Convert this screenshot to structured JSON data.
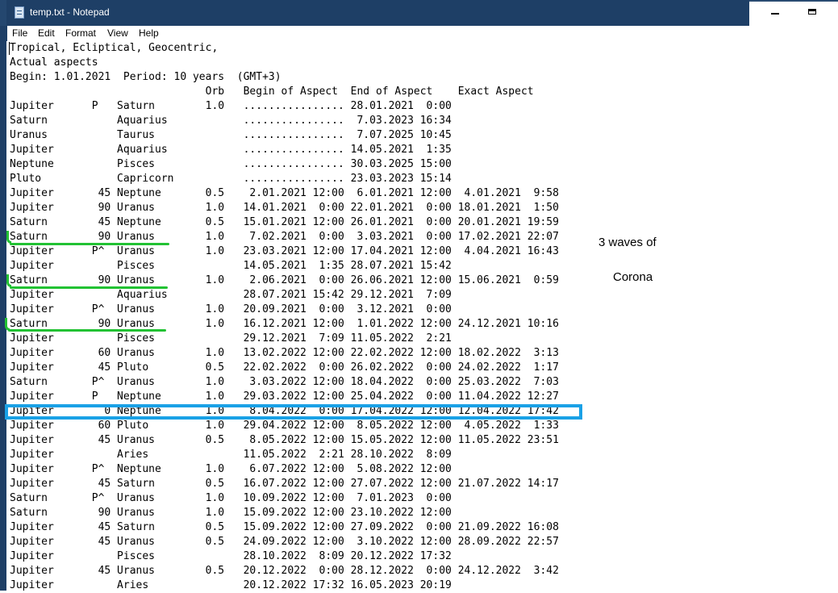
{
  "window": {
    "title": "temp.txt - Notepad",
    "controls": [
      "minimize",
      "maximize"
    ]
  },
  "menu": {
    "items": [
      {
        "label": "File"
      },
      {
        "label": "Edit"
      },
      {
        "label": "Format"
      },
      {
        "label": "View"
      },
      {
        "label": "Help"
      }
    ]
  },
  "document": {
    "lines": [
      "Tropical, Ecliptical, Geocentric,",
      "Actual aspects",
      "Begin: 1.01.2021  Period: 10 years  (GMT+3)",
      "                               Orb   Begin of Aspect  End of Aspect    Exact Aspect",
      "Jupiter      P   Saturn        1.0   ................ 28.01.2021  0:00",
      "Saturn           Aquarius            ................  7.03.2023 16:34",
      "Uranus           Taurus              ................  7.07.2025 10:45",
      "Jupiter          Aquarius            ................ 14.05.2021  1:35",
      "Neptune          Pisces              ................ 30.03.2025 15:00",
      "Pluto            Capricorn           ................ 23.03.2023 15:14",
      "Jupiter       45 Neptune       0.5    2.01.2021 12:00  6.01.2021 12:00  4.01.2021  9:58",
      "Jupiter       90 Uranus        1.0   14.01.2021  0:00 22.01.2021  0:00 18.01.2021  1:50",
      "Saturn        45 Neptune       0.5   15.01.2021 12:00 26.01.2021  0:00 20.01.2021 19:59",
      "Saturn        90 Uranus        1.0    7.02.2021  0:00  3.03.2021  0:00 17.02.2021 22:07",
      "Jupiter      P^  Uranus        1.0   23.03.2021 12:00 17.04.2021 12:00  4.04.2021 16:43",
      "Jupiter          Pisces              14.05.2021  1:35 28.07.2021 15:42",
      "Saturn        90 Uranus        1.0    2.06.2021  0:00 26.06.2021 12:00 15.06.2021  0:59",
      "Jupiter          Aquarius            28.07.2021 15:42 29.12.2021  7:09",
      "Jupiter      P^  Uranus        1.0   20.09.2021  0:00  3.12.2021  0:00",
      "Saturn        90 Uranus        1.0   16.12.2021 12:00  1.01.2022 12:00 24.12.2021 10:16",
      "Jupiter          Pisces              29.12.2021  7:09 11.05.2022  2:21",
      "Jupiter       60 Uranus        1.0   13.02.2022 12:00 22.02.2022 12:00 18.02.2022  3:13",
      "Jupiter       45 Pluto         0.5   22.02.2022  0:00 26.02.2022  0:00 24.02.2022  1:17",
      "Saturn       P^  Uranus        1.0    3.03.2022 12:00 18.04.2022  0:00 25.03.2022  7:03",
      "Jupiter      P   Neptune       1.0   29.03.2022 12:00 25.04.2022  0:00 11.04.2022 12:27",
      "Jupiter        0 Neptune       1.0    8.04.2022  0:00 17.04.2022 12:00 12.04.2022 17:42",
      "Jupiter       60 Pluto         1.0   29.04.2022 12:00  8.05.2022 12:00  4.05.2022  1:33",
      "Jupiter       45 Uranus        0.5    8.05.2022 12:00 15.05.2022 12:00 11.05.2022 23:51",
      "Jupiter          Aries               11.05.2022  2:21 28.10.2022  8:09",
      "Jupiter      P^  Neptune       1.0    6.07.2022 12:00  5.08.2022 12:00",
      "Jupiter       45 Saturn        0.5   16.07.2022 12:00 27.07.2022 12:00 21.07.2022 14:17",
      "Saturn       P^  Uranus        1.0   10.09.2022 12:00  7.01.2023  0:00",
      "Saturn        90 Uranus        1.0   15.09.2022 12:00 23.10.2022 12:00",
      "Jupiter       45 Saturn        0.5   15.09.2022 12:00 27.09.2022  0:00 21.09.2022 16:08",
      "Jupiter       45 Uranus        0.5   24.09.2022 12:00  3.10.2022 12:00 28.09.2022 22:57",
      "Jupiter          Pisces              28.10.2022  8:09 20.12.2022 17:32",
      "Jupiter       45 Uranus        0.5   20.12.2022  0:00 28.12.2022  0:00 24.12.2022  3:42",
      "Jupiter          Aries               20.12.2022 17:32 16.05.2023 20:19"
    ]
  },
  "annotations": {
    "note_line1": "3 waves of",
    "note_line2": "Corona",
    "green_color": "#22c233",
    "blue_color": "#1aa1e6"
  }
}
